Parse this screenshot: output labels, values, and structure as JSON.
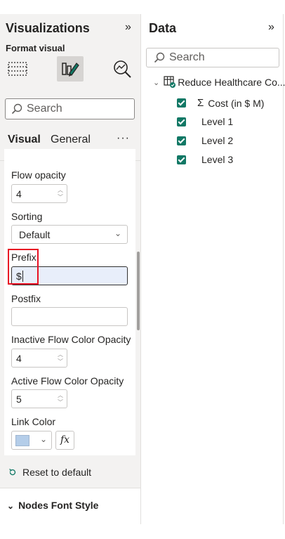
{
  "visualizations": {
    "title": "Visualizations",
    "collapse_glyph": "»",
    "subtitle": "Format visual",
    "icons": [
      "build-visual-icon",
      "format-visual-icon",
      "analytics-icon"
    ],
    "search_placeholder": "Search",
    "tabs": [
      {
        "label": "Visual",
        "active": true
      },
      {
        "label": "General",
        "active": false
      }
    ],
    "more_glyph": "···",
    "settings": {
      "flow_opacity_label": "Flow opacity",
      "flow_opacity_value": "4",
      "sorting_label": "Sorting",
      "sorting_value": "Default",
      "prefix_label": "Prefix",
      "prefix_value": "$",
      "postfix_label": "Postfix",
      "postfix_value": "",
      "inactive_label": "Inactive Flow Color Opacity",
      "inactive_value": "4",
      "active_label": "Active Flow Color Opacity",
      "active_value": "5",
      "link_color_label": "Link Color",
      "link_color": "#b4cde9",
      "fx_label": "fx"
    },
    "reset_label": "Reset to default",
    "nodes_font_label": "Nodes Font Style"
  },
  "data_pane": {
    "title": "Data",
    "collapse_glyph": "»",
    "search_placeholder": "Search",
    "table_name": "Reduce Healthcare Co...",
    "fields": [
      {
        "label": "Cost (in $ M)",
        "sigma": true
      },
      {
        "label": "Level 1",
        "sigma": false
      },
      {
        "label": "Level 2",
        "sigma": false
      },
      {
        "label": "Level 3",
        "sigma": false
      }
    ],
    "checkbox_color": "#117865"
  }
}
